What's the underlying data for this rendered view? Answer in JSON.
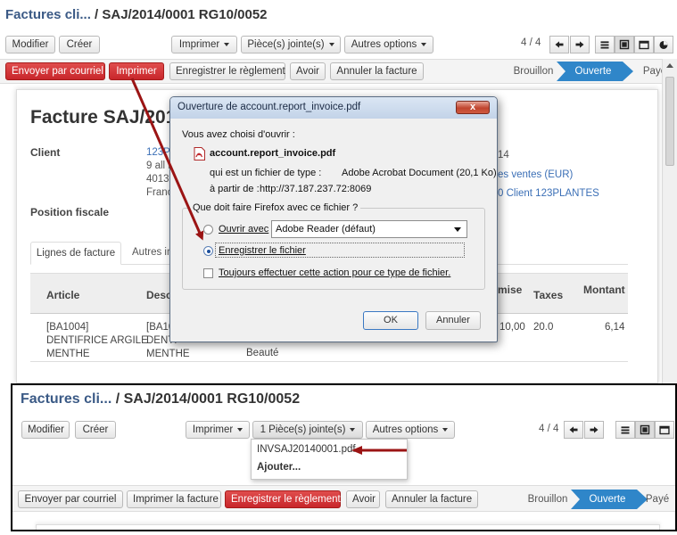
{
  "main": {
    "breadcrumb_parent": "Factures cli...",
    "breadcrumb_current": "/ SAJ/2014/0001 RG10/0052",
    "toolbar": {
      "edit": "Modifier",
      "create": "Créer",
      "print": "Imprimer",
      "attachments": "Pièce(s) jointe(s)",
      "more": "Autres options",
      "pager": "4 / 4"
    },
    "actions": {
      "send": "Envoyer par courriel",
      "print": "Imprimer",
      "register_payment": "Enregistrer le règlement",
      "credit_note": "Avoir",
      "cancel": "Annuler la facture"
    },
    "stages": [
      "Brouillon",
      "Ouverte",
      "Payé"
    ],
    "form": {
      "title": "Facture SAJ/201",
      "client_label": "Client",
      "client_lines": [
        "123PL",
        "9 all E",
        "40130",
        "Franc"
      ],
      "fiscal_label": "Position fiscale",
      "right_value_1": "14",
      "right_value_2": "es ventes (EUR)",
      "right_value_3": "0 Client 123PLANTES",
      "tab_lines": "Lignes de facture",
      "tab_other": "Autres in",
      "col_article": "Article",
      "col_desc": "Descr",
      "col_remise": "mise",
      "col_taxes": "Taxes",
      "col_montant": "Montant",
      "row": {
        "article": [
          "[BA1004]",
          "DENTIFRICE ARGILE",
          "MENTHE"
        ],
        "desc": [
          "[BA10",
          "DENTI",
          "MENTHE"
        ],
        "category": "Beauté",
        "remise": "10,00",
        "taxes": "20.0",
        "montant": "6,14"
      }
    }
  },
  "dialog": {
    "title": "Ouverture de account.report_invoice.pdf",
    "chosen_label": "Vous avez choisi d'ouvrir :",
    "filename": "account.report_invoice.pdf",
    "type_label": "qui est un fichier de type :",
    "type_value": "Adobe Acrobat Document (20,1 Ko)",
    "from_label": "à partir de :",
    "from_value": "http://37.187.237.72:8069",
    "question": "Que doit faire Firefox avec ce fichier ?",
    "open_with": "Ouvrir avec",
    "open_with_app": "Adobe Reader  (défaut)",
    "save_file": "Enregistrer le fichier",
    "always": "Toujours effectuer cette action pour ce type de fichier.",
    "ok": "OK",
    "cancel": "Annuler",
    "close": "x"
  },
  "inset": {
    "breadcrumb_parent": "Factures cli...",
    "breadcrumb_current": "/ SAJ/2014/0001 RG10/0052",
    "toolbar": {
      "edit": "Modifier",
      "create": "Créer",
      "print": "Imprimer",
      "attachments": "1 Pièce(s) jointe(s)",
      "more": "Autres options",
      "pager": "4 / 4"
    },
    "actions": {
      "send": "Envoyer par courriel",
      "print_invoice": "Imprimer la facture",
      "register_payment": "Enregistrer le règlement",
      "credit_note": "Avoir",
      "cancel": "Annuler la facture"
    },
    "stages": [
      "Brouillon",
      "Ouverte",
      "Payé"
    ],
    "dropdown": {
      "file": "INVSAJ20140001.pdf",
      "add": "Ajouter..."
    }
  },
  "colors": {
    "primary_red": "#c8262b",
    "stage_active": "#2f86c9",
    "breadcrumb": "#3b5a86",
    "annotation_arrow": "#9b1414"
  }
}
